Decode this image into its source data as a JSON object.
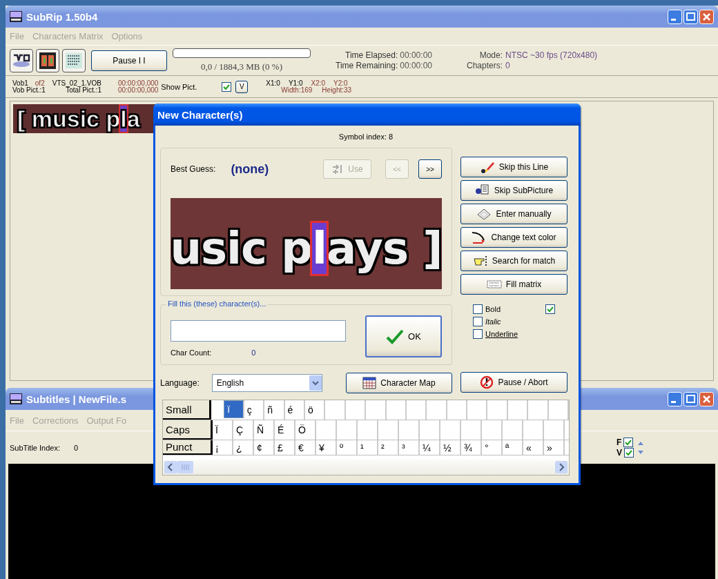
{
  "main_window": {
    "title": "SubRip 1.50b4",
    "menu": [
      "File",
      "Characters Matrix",
      "Options"
    ],
    "toolbar": {
      "pause_button": "Pause  I I",
      "progress": {
        "level": 0
      },
      "progress_text": "0,0 / 1884,3 MB (0 %)",
      "time_elapsed_label": "Time Elapsed:",
      "time_elapsed": "00:00:00",
      "time_remaining_label": "Time Remaining:",
      "time_remaining": "00:00:00",
      "mode_label": "Mode:",
      "mode": "NTSC ~30 fps (720x480)",
      "chapters_label": "Chapters:",
      "chapters": "0"
    },
    "info": {
      "vob": "Vob1",
      "of": "of2",
      "file": "VTS_02_1.VOB",
      "vob_pict": "Vob Pict.:1",
      "total_pict": "Total Pict.:1",
      "time_start": "00:00:00,000",
      "time_end": "00:00:00,000",
      "show_pict_label": "Show Pict.",
      "show_pict_checked": true,
      "v_button": "V",
      "x1": "X1:0",
      "y1": "Y1:0",
      "x2": "X2:0",
      "y2": "Y2:0",
      "width": "Width:169",
      "height": "Height:33"
    },
    "subtitle": {
      "before": "[ music p",
      "highlight": "l",
      "after": "a"
    }
  },
  "subtitles_window": {
    "title": "Subtitles | NewFile.s",
    "menu": [
      "File",
      "Corrections",
      "Output Fo"
    ],
    "index_label": "SubTitle Index:",
    "index": "0",
    "flags": [
      {
        "label": "F",
        "checked": true
      },
      {
        "label": "V",
        "checked": true
      }
    ]
  },
  "dialog": {
    "title": "New Character(s)",
    "symbol_index": "Symbol index: 8",
    "best_guess_label": "Best Guess:",
    "best_guess": "(none)",
    "use_button": {
      "label": "Use",
      "disabled": true
    },
    "prev_button": {
      "label": "<<",
      "disabled": true
    },
    "next_button": {
      "label": ">>",
      "disabled": false
    },
    "preview": {
      "before": "usic p",
      "highlight": "l",
      "after": "ays ]"
    },
    "actions": [
      {
        "label": "Skip this Line",
        "kind": "brush"
      },
      {
        "label": "Skip SubPicture",
        "kind": "pages"
      },
      {
        "label": "Enter manually",
        "kind": "keyboard"
      },
      {
        "label": "Change text color",
        "kind": "pen"
      },
      {
        "label": "Search for match",
        "kind": "hand"
      },
      {
        "label": "Fill matrix",
        "kind": "matrix"
      }
    ],
    "fill_label": "Fill this (these) character(s)...",
    "char_count_label": "Char Count:",
    "char_count": "0",
    "ok_button": "OK",
    "styles": [
      {
        "label": "Bold",
        "kind": "bold",
        "checked": false
      },
      {
        "label": "Italic",
        "kind": "italic",
        "checked": false
      },
      {
        "label": "Underline",
        "kind": "underline",
        "checked": false
      }
    ],
    "extra_checkbox": {
      "checked": true
    },
    "language_label": "Language:",
    "language": "English",
    "char_map_button": "Character Map",
    "abort_button": "Pause / Abort",
    "grid": [
      {
        "label": "Small",
        "cells": [
          {
            "char": "ï",
            "selected": true
          },
          {
            "char": "ç",
            "selected": false
          },
          {
            "char": "ñ",
            "selected": false
          },
          {
            "char": "é",
            "selected": false
          },
          {
            "char": "ö",
            "selected": false
          }
        ]
      },
      {
        "label": "Caps",
        "cells": [
          {
            "char": "Ï",
            "selected": false
          },
          {
            "char": "Ç",
            "selected": false
          },
          {
            "char": "Ñ",
            "selected": false
          },
          {
            "char": "É",
            "selected": false
          },
          {
            "char": "Ö",
            "selected": false
          }
        ]
      },
      {
        "label": "Punct",
        "cells": [
          {
            "char": "¡",
            "selected": false
          },
          {
            "char": "¿",
            "selected": false
          },
          {
            "char": "¢",
            "selected": false
          },
          {
            "char": "£",
            "selected": false
          },
          {
            "char": "€",
            "selected": false
          },
          {
            "char": "¥",
            "selected": false
          },
          {
            "char": "º",
            "selected": false
          },
          {
            "char": "¹",
            "selected": false
          },
          {
            "char": "²",
            "selected": false
          },
          {
            "char": "³",
            "selected": false
          },
          {
            "char": "¼",
            "selected": false
          },
          {
            "char": "½",
            "selected": false
          },
          {
            "char": "¾",
            "selected": false
          },
          {
            "char": "°",
            "selected": false
          },
          {
            "char": "ª",
            "selected": false
          },
          {
            "char": "«",
            "selected": false
          },
          {
            "char": "»",
            "selected": false
          }
        ]
      }
    ]
  }
}
